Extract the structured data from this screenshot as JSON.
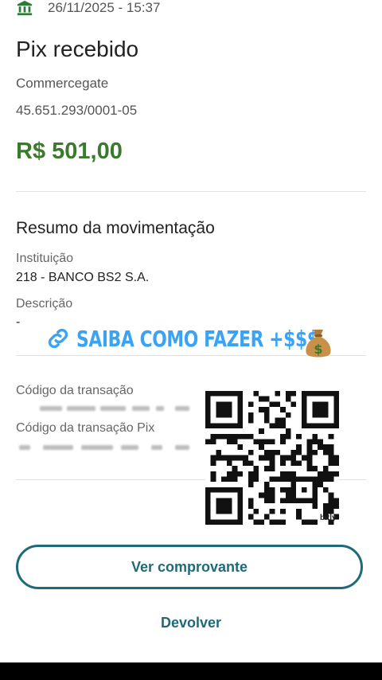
{
  "header": {
    "datetime": "26/11/2025 - 15:37"
  },
  "transaction": {
    "title": "Pix recebido",
    "merchant": "Commercegate",
    "cnpj": "45.651.293/0001-05",
    "amount": "R$ 501,00"
  },
  "summary": {
    "section_title": "Resumo da movimentação",
    "institution_label": "Instituição",
    "institution_value": "218 - BANCO BS2 S.A.",
    "description_label": "Descrição",
    "description_value": "-",
    "transaction_code_label": "Código da transação",
    "pix_code_label": "Código da transação Pix"
  },
  "promo": {
    "text": "SAIBA COMO FAZER +$$$",
    "qr_brand": "bitly"
  },
  "actions": {
    "view_receipt": "Ver comprovante",
    "refund": "Devolver"
  },
  "colors": {
    "amount": "#3a7a2c",
    "primary": "#1e6a7a",
    "promo": "#3aa3f5"
  },
  "icons": [
    "bank-icon",
    "link-icon",
    "money-bag-icon"
  ]
}
